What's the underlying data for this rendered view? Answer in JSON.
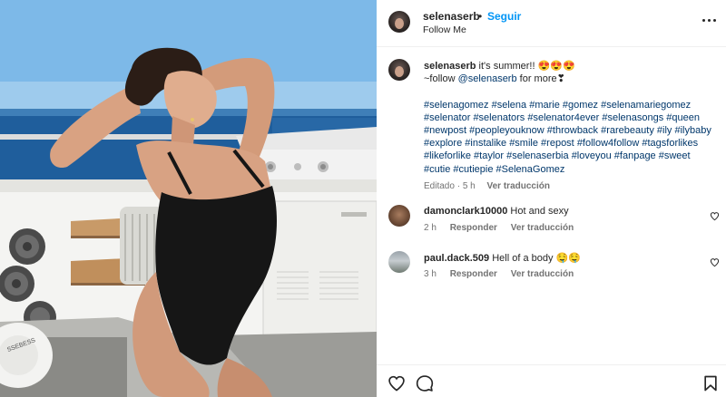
{
  "post": {
    "photo_alt": "",
    "towel_text": "SSEBESS"
  },
  "header": {
    "username": "selenaserb",
    "separator": "•",
    "follow_label": "Seguir",
    "subtitle": "Follow Me",
    "icons": {
      "avatar": "avatar",
      "more": "more-options-icon"
    }
  },
  "caption": {
    "username": "selenaserb",
    "text": "it's summer!! 😍😍😍",
    "line2_prefix": "~follow",
    "mention": "@selenaserb",
    "line2_suffix": "for more❣",
    "hashtags": [
      "#selenagomez",
      "#selena",
      "#marie",
      "#gomez",
      "#selenamariegomez",
      "#selenator",
      "#selenators",
      "#selenator4ever",
      "#selenasongs",
      "#queen",
      "#newpost",
      "#peopleyouknow",
      "#throwback",
      "#rarebeauty",
      "#ily",
      "#ilybaby",
      "#explore",
      "#instalike",
      "#smile",
      "#repost",
      "#follow4follow",
      "#tagsforlikes",
      "#likeforlike",
      "#taylor",
      "#selenaserbia",
      "#loveyou",
      "#fanpage",
      "#sweet",
      "#cutie",
      "#cutiepie",
      "#SelenaGomez"
    ],
    "edited": "Editado",
    "time": "5 h",
    "translate": "Ver traducción"
  },
  "comments": [
    {
      "username": "damonclark10000",
      "text": "Hot and sexy",
      "time": "2 h",
      "reply": "Responder",
      "translate": "Ver traducción",
      "icon": "heart-outline-icon"
    },
    {
      "username": "paul.dack.509",
      "text": "Hell of a body 🤤🤤",
      "time": "3 h",
      "reply": "Responder",
      "translate": "Ver traducción",
      "icon": "heart-outline-icon"
    }
  ],
  "footer": {
    "icons": [
      "heart-outline-icon",
      "comment-icon",
      "bookmark-icon"
    ]
  },
  "colors": {
    "link_blue": "#0095f6",
    "hashtag_blue": "#00376b",
    "muted_gray": "#737373",
    "text": "#262626"
  }
}
